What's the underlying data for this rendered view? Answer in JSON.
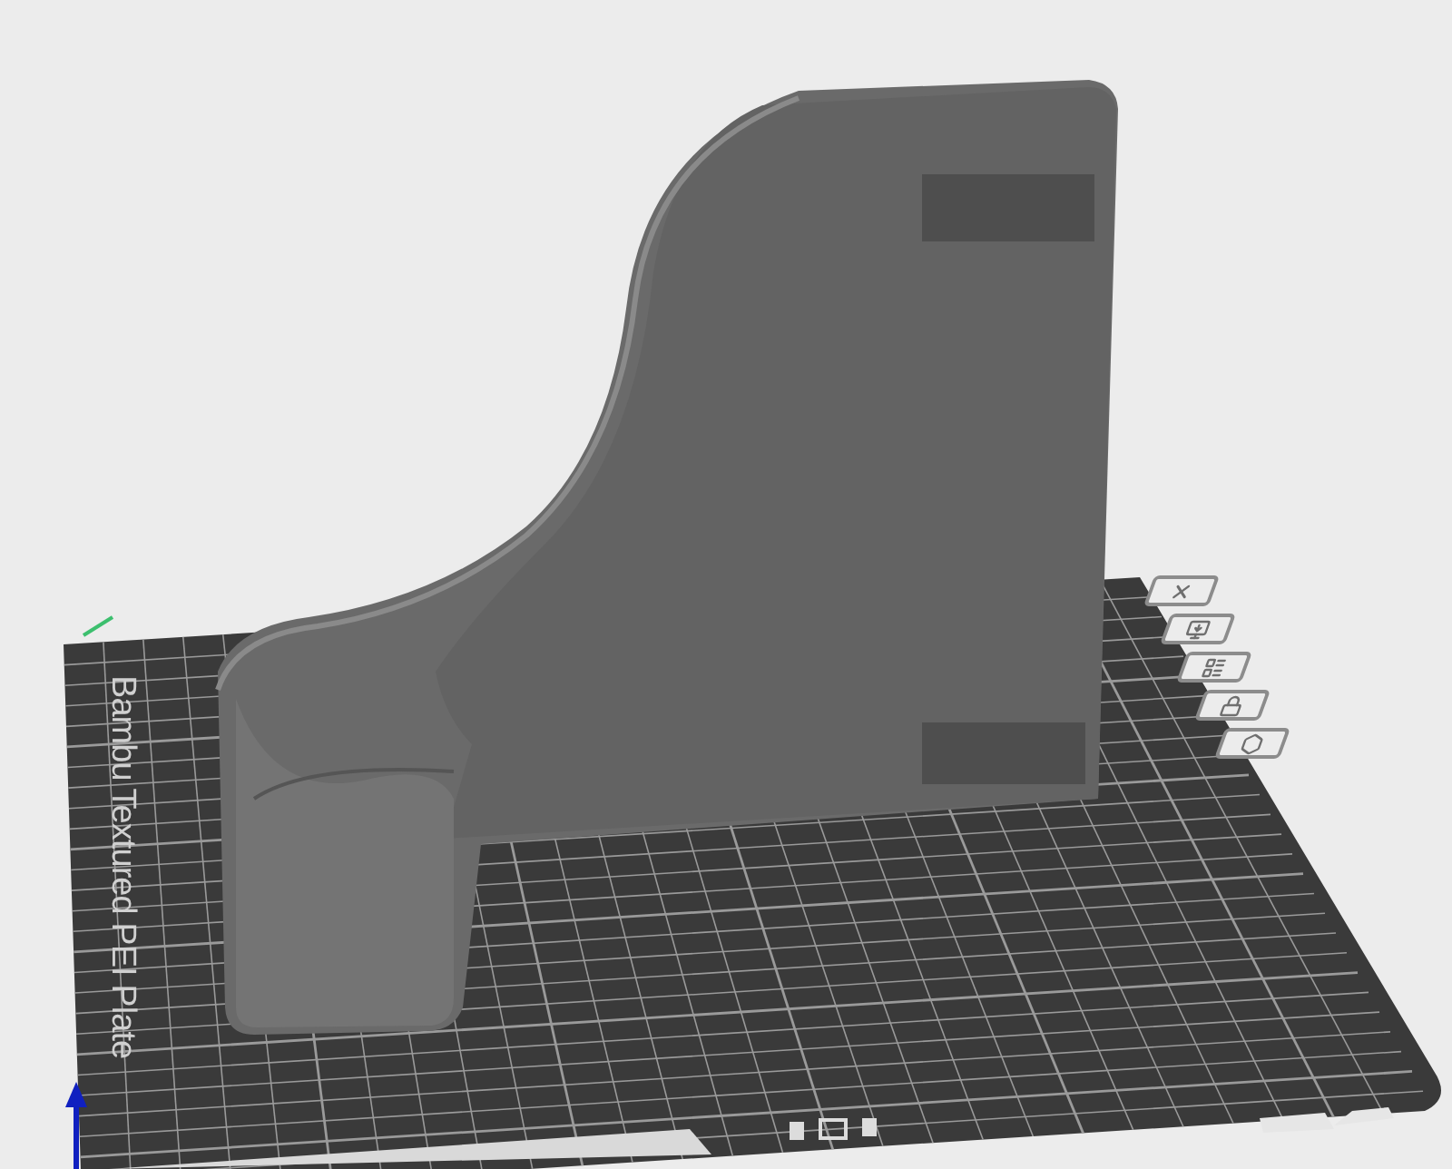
{
  "viewport": {
    "plate_label": "Bambu Textured PEI Plate"
  },
  "plate_tools": [
    {
      "kind": "close"
    },
    {
      "kind": "arrange"
    },
    {
      "kind": "layout"
    },
    {
      "kind": "lock"
    },
    {
      "kind": "settings"
    }
  ]
}
